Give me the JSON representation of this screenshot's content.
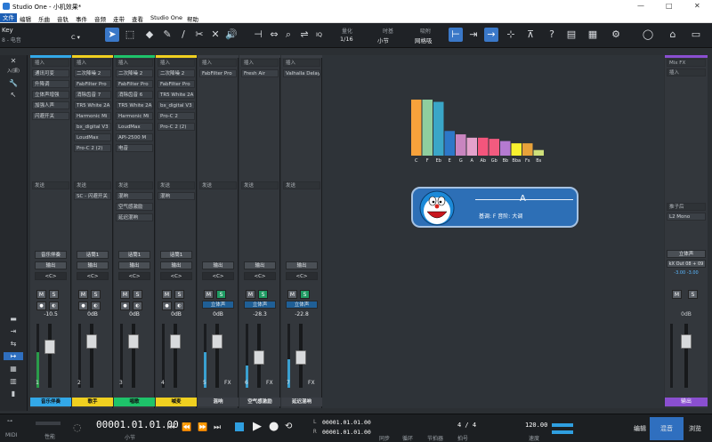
{
  "window": {
    "title": "Studio One - 小机效果*",
    "controls": [
      "—",
      "□",
      "✕"
    ]
  },
  "menu": [
    "文件",
    "编辑",
    "乐曲",
    "音轨",
    "事件",
    "音频",
    "走带",
    "查看",
    "Studio One",
    "帮助"
  ],
  "toolbar": {
    "key_label": "Key",
    "key_sub": "8 - 电音",
    "key_value": "C ▾",
    "quant_label": "量化",
    "quant_value": "1/16",
    "timebase_label": "时基",
    "timebase_value": "小节",
    "snap_label": "吸附",
    "snap_value": "网格吸",
    "iq": "IQ"
  },
  "colors": {
    "accent": "#2f6fbf",
    "yellow": "#f0d020",
    "green": "#1f9b63",
    "purple": "#8a4fd0"
  },
  "channels": [
    {
      "name": "音乐伴奏",
      "num": "1",
      "vol": "-10.5",
      "color": "#33a8e8",
      "out": "输出",
      "send": "音乐伴奏",
      "inserts": [
        "插入",
        "通讯可变",
        "升降调",
        "立体声增强",
        "加强人声",
        "闪避开关"
      ],
      "sends": [
        "发送"
      ],
      "lvl": 0.55
    },
    {
      "name": "歌手",
      "num": "2",
      "vol": "0dB",
      "color": "#f0d020",
      "out": "输出",
      "send": "话筒1",
      "inserts": [
        "插入",
        "二次降噪 2",
        "FabFilter Pro",
        "消除齿音 7",
        "TR5 White 2A",
        "Harmonic Mi",
        "bx_digital V3",
        "LoudMax",
        "Pro-C 2 (2)"
      ],
      "sends": [
        "发送",
        "SC - 闪避开关"
      ],
      "lvl": 0.0
    },
    {
      "name": "唱歌",
      "num": "3",
      "vol": "0dB",
      "color": "#1ec36a",
      "out": "输出",
      "send": "话筒1",
      "inserts": [
        "插入",
        "二次降噪 2",
        "FabFilter Pro",
        "消除齿音 6",
        "TR5 White 2A",
        "Harmonic Mi",
        "LoudMax",
        "API-2500 M",
        "电音"
      ],
      "sends": [
        "发送",
        "混响",
        "空气感激励",
        "延迟混响"
      ],
      "lvl": 0.0
    },
    {
      "name": "喊麦",
      "num": "4",
      "vol": "0dB",
      "color": "#f0d020",
      "out": "输出",
      "send": "话筒1",
      "inserts": [
        "插入",
        "二次降噪 2",
        "FabFilter Pro",
        "TR5 White 2A",
        "bx_digital V3",
        "Pro-C 2",
        "Pro-C 2 (2)"
      ],
      "sends": [
        "发送",
        "混响"
      ],
      "lvl": 0.0
    },
    {
      "name": "混响",
      "num": "5",
      "vol": "0dB",
      "color": "#3a3e44",
      "out": "输出",
      "send": "",
      "inserts": [
        "插入",
        "FabFilter Pro"
      ],
      "sends": [
        "发送"
      ],
      "lvl": 0.55,
      "fx": "FX",
      "stereo": "立体声"
    },
    {
      "name": "空气感激励",
      "num": "6",
      "vol": "-28.3",
      "color": "#3a3e44",
      "out": "输出",
      "send": "",
      "inserts": [
        "插入",
        "Fresh Air"
      ],
      "sends": [
        "发送"
      ],
      "lvl": 0.35,
      "fx": "FX",
      "stereo": "立体声"
    },
    {
      "name": "延迟混响",
      "num": "7",
      "vol": "-22.8",
      "color": "#3a3e44",
      "out": "输出",
      "send": "",
      "inserts": [
        "插入",
        "Valhalla Delay"
      ],
      "sends": [
        "发送"
      ],
      "lvl": 0.45,
      "fx": "FX",
      "stereo": "立体声"
    }
  ],
  "chart_data": {
    "type": "bar",
    "categories": [
      "C",
      "F",
      "Eb",
      "E",
      "G",
      "A",
      "Ab",
      "Gb",
      "Bb",
      "Bba",
      "Fs",
      "Bs"
    ],
    "values": [
      100,
      100,
      96,
      44,
      38,
      32,
      32,
      30,
      26,
      22,
      22,
      10
    ],
    "colors": [
      "#f7a23b",
      "#8fce9e",
      "#3aa6c7",
      "#2d78c8",
      "#c985c0",
      "#e4a2cc",
      "#f3557c",
      "#f25b7f",
      "#b57ad1",
      "#f8f12e",
      "#e8a23a",
      "#cfe07a"
    ],
    "title": "",
    "xlabel": "",
    "ylabel": "",
    "ylim": [
      0,
      100
    ]
  },
  "badge": {
    "key": "A",
    "info": "基调: F  音阶: 大调"
  },
  "mixfx": {
    "title": "Mix FX",
    "insert": "插入",
    "post": "推子后",
    "plugin": "L2 Mono",
    "out_label": "立体声",
    "out": "kX Out 08 + 09",
    "vals": "-3.00  -3.00",
    "name": "输出",
    "ms": [
      "M",
      "S"
    ]
  },
  "transport": {
    "midi": "MIDI",
    "perf": "性能",
    "time": "00001.01.01.00",
    "time_unit": "小节",
    "l": "L",
    "r": "R",
    "l_val": "00001.01.01.00",
    "r_val": "00001.01.01.00",
    "sig": "4 / 4",
    "sig_label": "拍号",
    "ts_label": "节拍器",
    "tempo": "120.00",
    "tempo_label": "速度",
    "sync": "同步",
    "loop": "循环",
    "tabs": [
      "编辑",
      "混音",
      "浏览"
    ],
    "active_tab": 1
  }
}
